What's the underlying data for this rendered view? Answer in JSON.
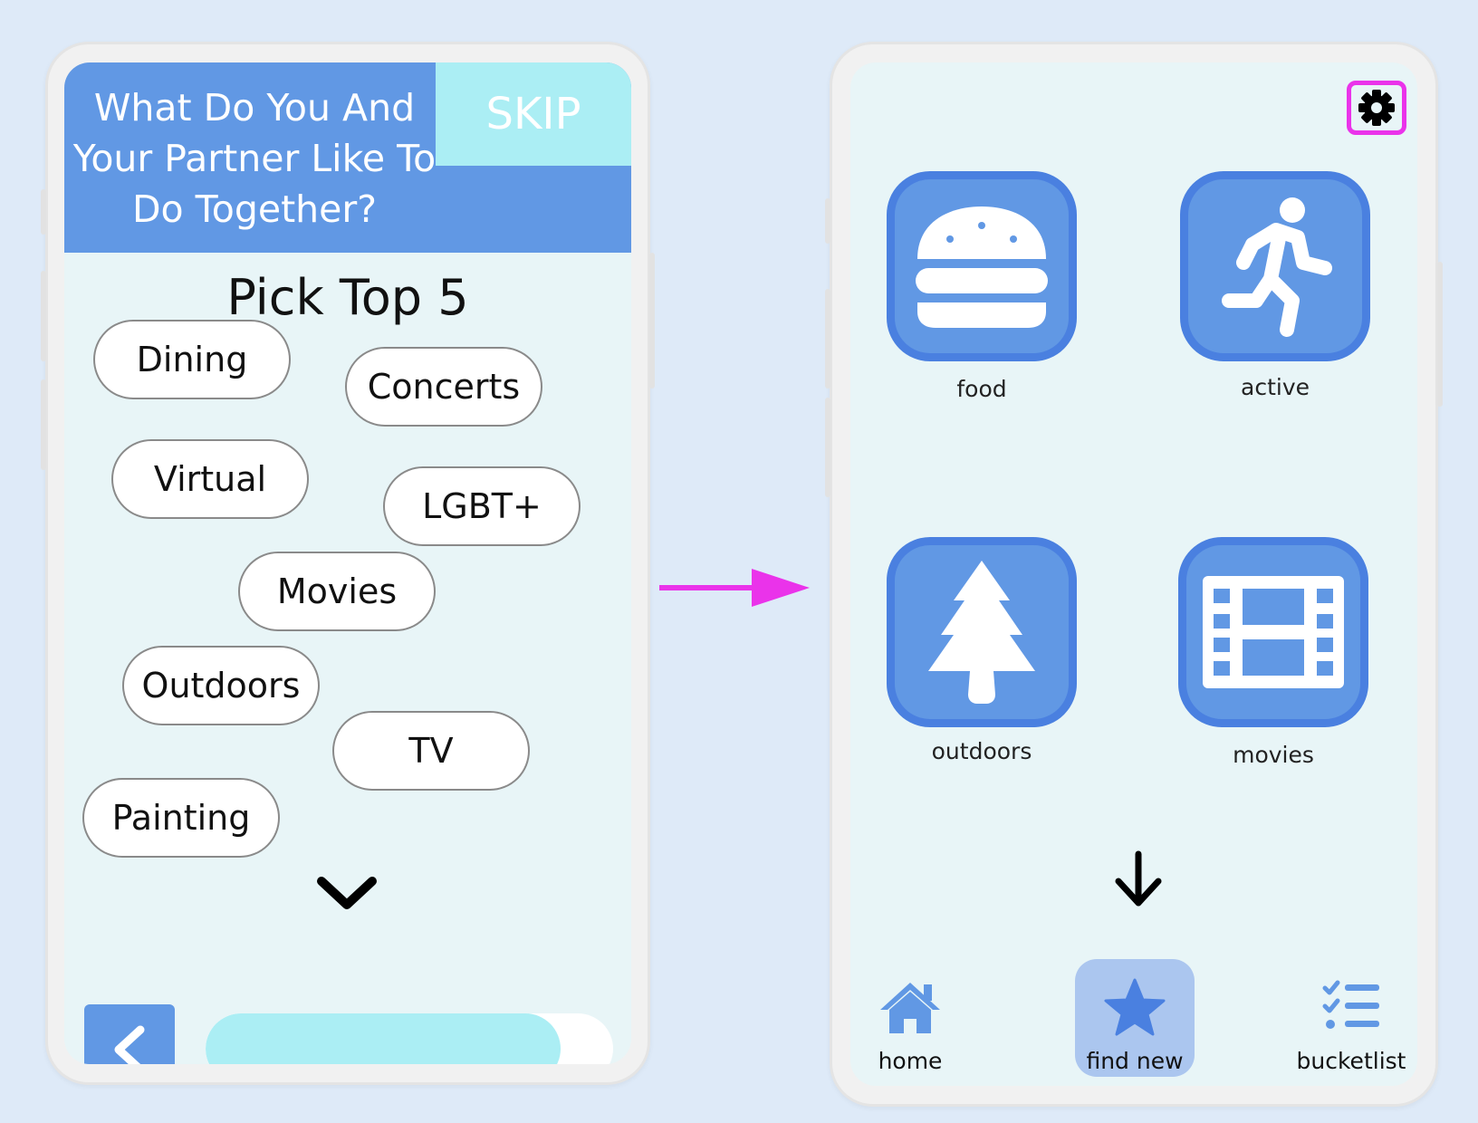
{
  "onboarding": {
    "question": "What Do You And Your Partner Like To Do Together?",
    "skip_label": "SKIP",
    "pick_title": "Pick Top 5",
    "interests": [
      "Dining",
      "Concerts",
      "Virtual",
      "LGBT+",
      "Movies",
      "Outdoors",
      "TV",
      "Painting"
    ],
    "more_icon": "chevron-down-icon",
    "back_icon": "chevron-left-icon",
    "progress_fraction": 0.87
  },
  "find_new": {
    "settings_icon": "gear-icon",
    "categories": [
      {
        "label": "food",
        "icon": "burger-icon"
      },
      {
        "label": "active",
        "icon": "running-person-icon"
      },
      {
        "label": "outdoors",
        "icon": "tree-icon"
      },
      {
        "label": "movies",
        "icon": "film-icon"
      }
    ],
    "scroll_icon": "arrow-down-icon",
    "nav": [
      {
        "label": "home",
        "icon": "home-icon",
        "active": false
      },
      {
        "label": "find new",
        "icon": "star-icon",
        "active": true
      },
      {
        "label": "bucketlist",
        "icon": "checklist-icon",
        "active": false
      }
    ]
  },
  "colors": {
    "background": "#deeaf8",
    "primary_blue": "#6198e4",
    "light_cyan": "#abeef4",
    "screen_bg": "#e8f5f7",
    "highlight_magenta": "#ea33ea",
    "active_nav": "#abc6ef"
  }
}
